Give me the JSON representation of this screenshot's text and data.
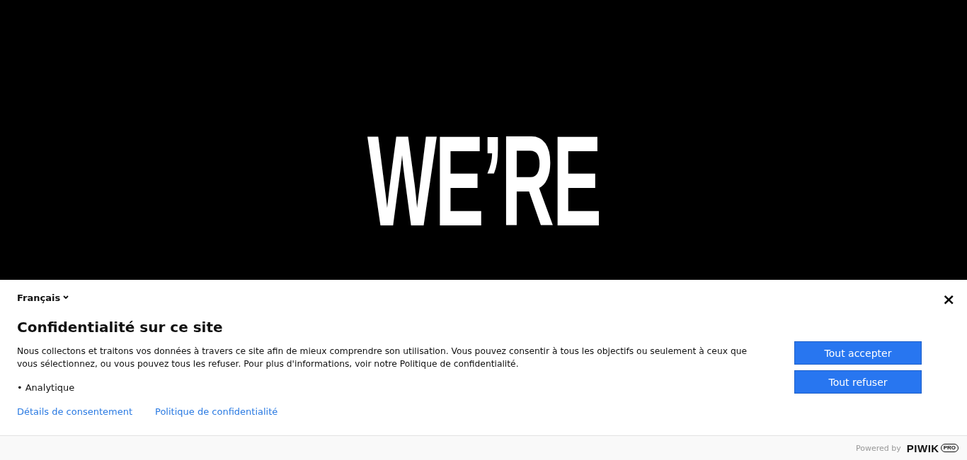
{
  "hero": {
    "lines": [
      "WE’RE"
    ]
  },
  "consent_banner": {
    "language": "Français",
    "close": "×",
    "title": "Confidentialité sur ce site",
    "description": "Nous collectons et traitons vos données à travers ce site afin de mieux comprendre son utilisation. Vous pouvez consentir à tous les objectifs ou seulement à ceux que vous sélectionnez, ou vous pouvez tous les refuser. Pour plus d'informations, voir notre Politique de confidentialité.",
    "purposes": [
      {
        "marker": "•",
        "label": "Analytique"
      }
    ],
    "links": [
      "Détails de consentement",
      "Politique de confidentialité"
    ],
    "buttons": [
      "Tout accepter",
      "Tout refuser"
    ],
    "footer": {
      "powered_by": "Powered by",
      "logo_text": "PIWIK",
      "logo_badge": "PRO"
    }
  }
}
